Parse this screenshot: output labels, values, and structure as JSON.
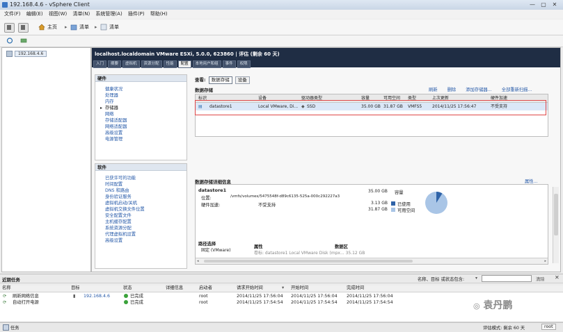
{
  "window": {
    "title": "192.168.4.6 - vSphere Client",
    "controls": [
      "—",
      "▢",
      "✕"
    ]
  },
  "menu": [
    "文件(F)",
    "编辑(E)",
    "视图(W)",
    "清单(N)",
    "系统管理(A)",
    "插件(P)",
    "帮助(H)"
  ],
  "nav": {
    "home": "主页",
    "inv1": "清单",
    "inv2": "清单"
  },
  "tree": {
    "host": "192.168.4.6"
  },
  "host_header": {
    "title": "localhost.localdomain VMware ESXi, 5.0.0, 623860 | 评估 (剩余 60 天)",
    "tabs": [
      "入门",
      "摘要",
      "虚拟机",
      "资源分配",
      "性能",
      "配置",
      "本地用户和组",
      "事件",
      "权限"
    ],
    "active_tab": "配置"
  },
  "hardware": {
    "title": "硬件",
    "items": [
      "健康状况",
      "处理器",
      "内存",
      "存储器",
      "网络",
      "存储适配器",
      "网络适配器",
      "高级设置",
      "电源管理"
    ],
    "current": "存储器"
  },
  "software": {
    "title": "软件",
    "items": [
      "已获许可的功能",
      "时间配置",
      "DNS 和路由",
      "身份验证服务",
      "虚拟机启动/关机",
      "虚拟机交换文件位置",
      "安全配置文件",
      "主机缓存配置",
      "系统资源分配",
      "代理虚拟机设置",
      "高级设置"
    ]
  },
  "view": {
    "label": "查看:",
    "btn_datastore": "数据存储",
    "btn_device": "设备"
  },
  "datastores": {
    "title": "数据存储",
    "actions": [
      "刷新",
      "删除",
      "添加存储器...",
      "全部重新扫描..."
    ],
    "columns": [
      "标识",
      "设备",
      "驱动器类型",
      "容量",
      "可用空间",
      "类型",
      "上次更新",
      "硬件加速"
    ],
    "rows": [
      [
        "datastore1",
        "Local VMware, Di...",
        "SSD",
        "35.00 GB",
        "31.87 GB",
        "VMFS5",
        "2014/11/25 17:56:47",
        "不受支持"
      ]
    ]
  },
  "details": {
    "title": "数据存储详细信息",
    "props_link": "属性...",
    "name": "datastore1",
    "location_label": "位置:",
    "location": "/vmfs/volumes/5475548f-d89c6135-525a-000c292227a3",
    "hwaccel_label": "硬件加速:",
    "hwaccel": "不受支持",
    "capacity_value": "35.00 GB",
    "capacity_label": "容量",
    "used_value": "3.13 GB",
    "used_label": "已使用",
    "free_value": "31.87 GB",
    "free_label": "可用空间",
    "path_title": "路径选择",
    "path_value": "固定 (VMware)",
    "prop_title": "属性",
    "extent_title": "数据区",
    "cut_row": "卷标:     datastore1     Local VMware Disk (mpx...     35.12 GB"
  },
  "recent": {
    "title": "近期任务",
    "filter_label": "名称、目标 或状态包含:",
    "clear": "清除",
    "columns": [
      "名称",
      "目标",
      "状态",
      "详细信息",
      "启动者",
      "请求开始时间",
      "开始时间",
      "完成时间"
    ],
    "rows": [
      [
        "刷新网络信息",
        "192.168.4.6",
        "已完成",
        "",
        "root",
        "2014/11/25 17:56:04",
        "2014/11/25 17:56:04",
        "2014/11/25 17:56:04"
      ],
      [
        "自动打开电源",
        "",
        "已完成",
        "",
        "root",
        "2014/11/25 17:54:54",
        "2014/11/25 17:54:54",
        "2014/11/25 17:54:54"
      ]
    ]
  },
  "status": {
    "tasks": "任务",
    "eval": "评估模式: 剩余 60 天",
    "user": "root"
  },
  "watermark": "袁丹鹏",
  "colors": {
    "header_bg": "#1f2d44",
    "selection": "#dbe7f7",
    "highlight_box": "#e04646",
    "pie_used": "#2f63a8",
    "pie_free": "#a9c5e6"
  }
}
